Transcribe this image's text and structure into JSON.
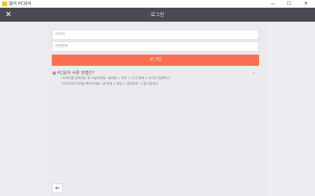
{
  "window": {
    "title": "릴리 PC뷰어",
    "minimize_glyph": "—",
    "maximize_glyph": "☐",
    "close_glyph": "✕"
  },
  "header": {
    "title": "로그인",
    "close_glyph": "✕"
  },
  "form": {
    "id_placeholder": "아이디",
    "password_placeholder": "비밀번호",
    "login_label": "로그인"
  },
  "faq": {
    "question": "PC뷰어 사용 방법은?",
    "answer_lines": [
      "· 아이디를 등록하신 후 사용하세요. 내서재 > 관리 > 기기 등록 > 아이디 등록하기",
      "· PC뷰어의 버전을 확인하세요. 내 서재 > 버전 > 업데이트 > 앱 다운로드"
    ]
  },
  "footer": {
    "back_glyph": "←"
  },
  "colors": {
    "header_bg": "#4a4a55",
    "content_bg": "#ebebef",
    "side_bg": "#eeeef2",
    "accent": "#fc6e51"
  }
}
